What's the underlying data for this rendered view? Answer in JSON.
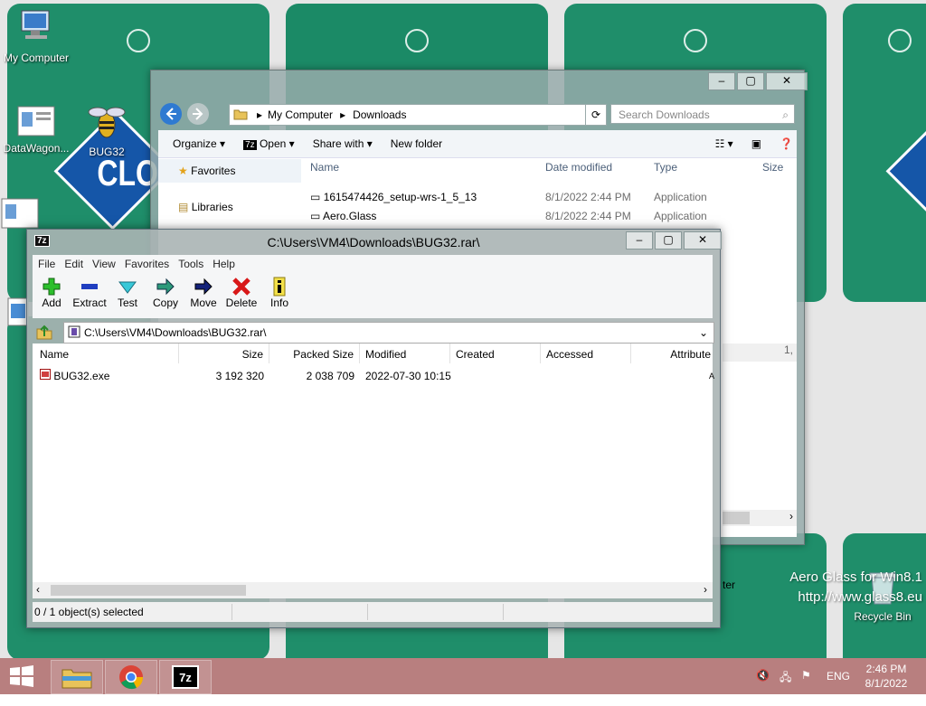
{
  "desktop": {
    "icons": [
      {
        "label": "My Computer"
      },
      {
        "label": "DataWagon..."
      },
      {
        "label": "BUG32"
      },
      {
        "label": "Recycle Bin"
      }
    ],
    "watermark_line1": "Aero Glass for Win8.1",
    "watermark_line2": "http://www.glass8.eu"
  },
  "explorer": {
    "breadcrumb": [
      "My Computer",
      "Downloads"
    ],
    "search_placeholder": "Search Downloads",
    "toolbar": {
      "organize": "Organize",
      "open": "Open",
      "share_with": "Share with",
      "new_folder": "New folder"
    },
    "sidebar": [
      "Favorites",
      "Libraries"
    ],
    "columns": [
      "Name",
      "Date modified",
      "Type",
      "Size"
    ],
    "rows": [
      {
        "name": "1615474426_setup-wrs-1_5_13",
        "date": "8/1/2022 2:44 PM",
        "type": "Application"
      },
      {
        "name": "Aero.Glass",
        "date": "8/1/2022 2:44 PM",
        "type": "Application"
      }
    ],
    "partial_text_1": "1,",
    "partial_text_2": "ter"
  },
  "sevenzip": {
    "app_icon": "7z",
    "title": "C:\\Users\\VM4\\Downloads\\BUG32.rar\\",
    "menu": [
      "File",
      "Edit",
      "View",
      "Favorites",
      "Tools",
      "Help"
    ],
    "toolbar": [
      {
        "label": "Add",
        "icon": "add-icon"
      },
      {
        "label": "Extract",
        "icon": "extract-icon"
      },
      {
        "label": "Test",
        "icon": "test-icon"
      },
      {
        "label": "Copy",
        "icon": "copy-icon"
      },
      {
        "label": "Move",
        "icon": "move-icon"
      },
      {
        "label": "Delete",
        "icon": "delete-icon"
      },
      {
        "label": "Info",
        "icon": "info-icon"
      }
    ],
    "path": "C:\\Users\\VM4\\Downloads\\BUG32.rar\\",
    "columns": [
      "Name",
      "Size",
      "Packed Size",
      "Modified",
      "Created",
      "Accessed",
      "Attribute"
    ],
    "files": [
      {
        "name": "BUG32.exe",
        "size": "3 192 320",
        "packed": "2 038 709",
        "modified": "2022-07-30 10:15",
        "created": "",
        "accessed": "",
        "attr": "A"
      }
    ],
    "status": "0 / 1 object(s) selected"
  },
  "taskbar": {
    "items": [
      "start-button",
      "file-explorer",
      "chrome",
      "7zip"
    ],
    "lang": "ENG",
    "time": "2:46 PM",
    "date": "8/1/2022"
  },
  "colors": {
    "wallpaper_green": "#1f8e6a",
    "taskbar": "#b47878",
    "brand_blue": "#1556a8"
  }
}
